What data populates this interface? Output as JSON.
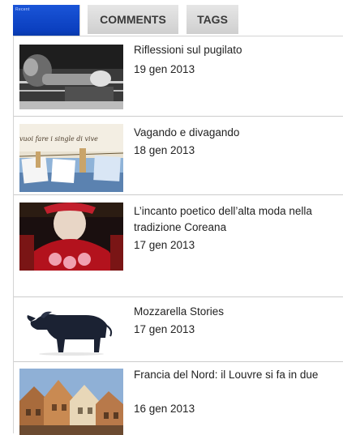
{
  "tabs": {
    "active_label": "Recent",
    "comments_label": "COMMENTS",
    "tags_label": "TAGS"
  },
  "posts": [
    {
      "title": "Riflessioni sul pugilato",
      "date": "19 gen 2013",
      "thumb": "boxing-photo"
    },
    {
      "title": "Vagando e divagando",
      "date": "18 gen 2013",
      "thumb": "clothesline-photo",
      "thumb_caption": "vuoi fare i single di vive"
    },
    {
      "title": "L’incanto poetico dell’alta moda nella tradizione Coreana",
      "date": "17 gen 2013",
      "thumb": "korean-dress-photo"
    },
    {
      "title": "Mozzarella Stories",
      "date": "17 gen 2013",
      "thumb": "buffalo-photo"
    },
    {
      "title": "Francia del Nord: il Louvre si fa in due",
      "date": "16 gen 2013",
      "thumb": "old-houses-photo"
    }
  ]
}
